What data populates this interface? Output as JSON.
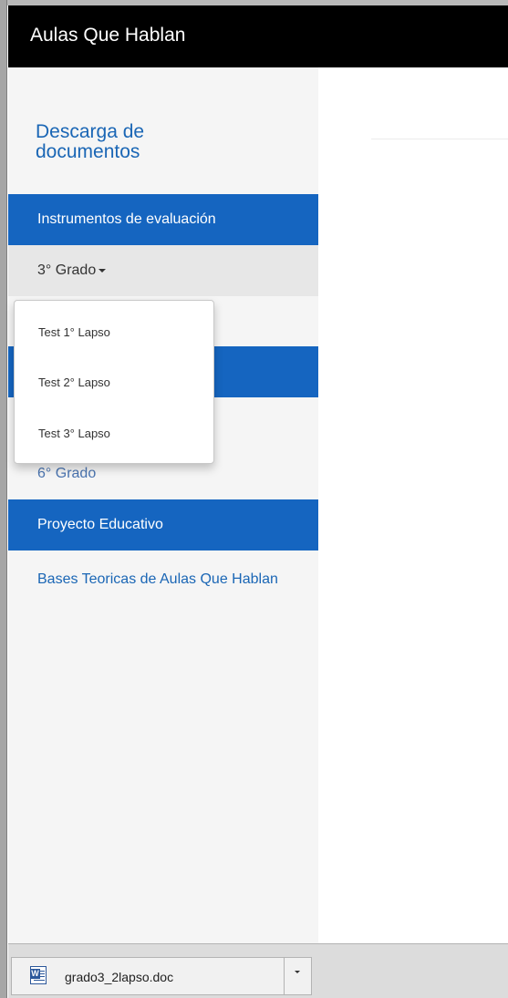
{
  "navbar": {
    "brand": "Aulas Que Hablan"
  },
  "sidebar": {
    "heading_line1": "Descarga de",
    "heading_line2": "documentos",
    "section_evaluacion": "Instrumentos de evaluación",
    "grade_3": "3° Grado",
    "grade_6": "6° Grado",
    "section_proyecto": "Proyecto Educativo",
    "bases_link": "Bases Teoricas de Aulas Que Hablan"
  },
  "dropdown": {
    "items": [
      {
        "label": "Test 1° Lapso"
      },
      {
        "label": "Test 2° Lapso"
      },
      {
        "label": "Test 3° Lapso"
      }
    ]
  },
  "download_bar": {
    "file_name": "grado3_2lapso.doc",
    "file_icon": "word-doc-icon",
    "menu_icon": "chevron-down-icon"
  },
  "colors": {
    "navbar_bg": "#000000",
    "section_bg": "#1565c0",
    "link": "#1a66b5",
    "sidebar_bg": "#f5f5f5"
  }
}
